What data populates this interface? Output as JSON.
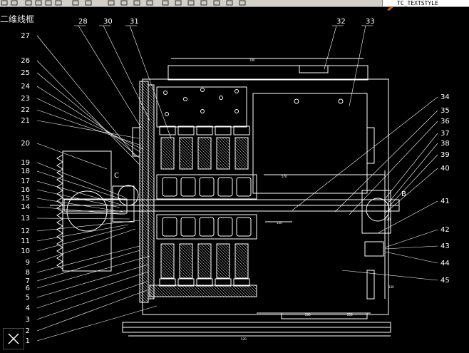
{
  "app": {
    "toolbar_icons": [
      "window-icon",
      "layer-icon",
      "cut-icon",
      "copy-icon",
      "paste-icon",
      "brush-icon",
      "undo-icon",
      "redo-icon",
      "pan-icon",
      "zoom-realtime-icon",
      "zoom-window-icon",
      "zoom-previous-icon",
      "properties-icon",
      "design-center-icon",
      "tool-palette-icon",
      "sheet-set-icon",
      "markup-icon",
      "calc-icon",
      "help-icon"
    ],
    "command_input": "TC_TEXTSTYLE",
    "command_icon": "pen-icon"
  },
  "viewport": {
    "label": "二维线框"
  },
  "drawing": {
    "callout_numbers_left": [
      "27",
      "26",
      "25",
      "24",
      "23",
      "22",
      "21",
      "20",
      "19",
      "18",
      "17",
      "16",
      "15",
      "14",
      "13",
      "12",
      "11",
      "10",
      "9",
      "8",
      "7",
      "6",
      "5",
      "4",
      "3",
      "2",
      "1"
    ],
    "callout_numbers_top": [
      "28",
      "30",
      "31",
      "32",
      "33"
    ],
    "callout_numbers_right": [
      "34",
      "35",
      "36",
      "37",
      "38",
      "39",
      "40",
      "41",
      "42",
      "43",
      "44",
      "45"
    ],
    "view_letters": [
      "C",
      "B"
    ],
    "dimension_texts": [
      "190",
      "570",
      "150",
      "200",
      "250",
      "120",
      "520",
      "330"
    ]
  },
  "colors": {
    "background": "#000000",
    "line": "#ffffff",
    "hatch": "#ffffff",
    "toolbar": "#d4d0c8"
  }
}
